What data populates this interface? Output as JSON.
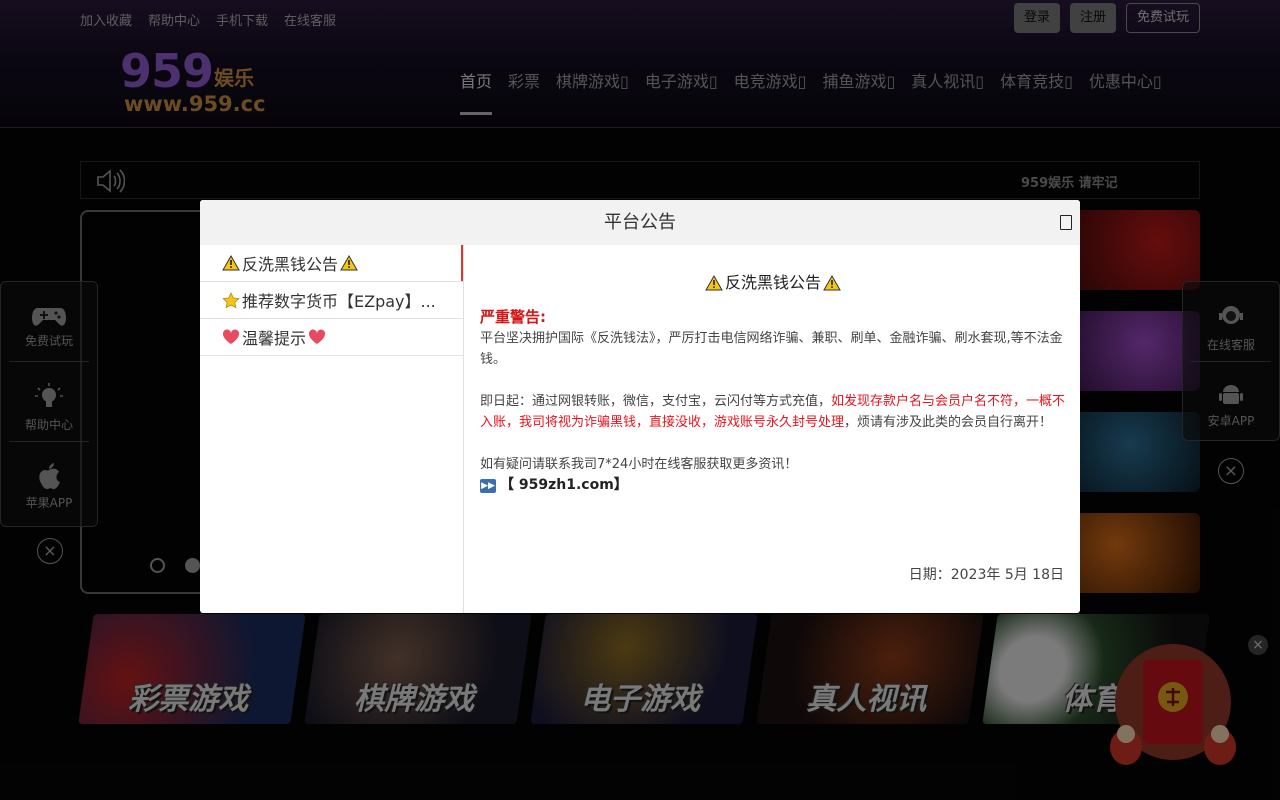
{
  "top_links": [
    "加入收藏",
    "帮助中心",
    "手机下载",
    "在线客服"
  ],
  "auth": {
    "login": "登录",
    "register": "注册",
    "trial": "免费试玩"
  },
  "logo": {
    "number": "959",
    "brand": "娱乐",
    "url": "www.959.cc"
  },
  "nav": [
    "首页",
    "彩票",
    "棋牌游戏▯",
    "电子游戏▯",
    "电竞游戏▯",
    "捕鱼游戏▯",
    "真人视讯▯",
    "体育竞技▯",
    "优惠中心▯"
  ],
  "marquee": {
    "text": "959娱乐 请牢记"
  },
  "left_widgets": [
    "免费试玩",
    "帮助中心",
    "苹果APP"
  ],
  "right_widgets": [
    "在线客服",
    "安卓APP"
  ],
  "games": [
    "彩票游戏",
    "棋牌游戏",
    "电子游戏",
    "真人视讯",
    "体育"
  ],
  "modal": {
    "title": "平台公告",
    "tabs": [
      {
        "label": "反洗黑钱公告",
        "icon": "warning-icon",
        "icon_after": "warning-icon"
      },
      {
        "label": "推荐数字货币【EZpay】...",
        "icon": "star-icon"
      },
      {
        "label": "温馨提示",
        "icon": "heart-icon",
        "icon_after": "heart-icon"
      }
    ],
    "content": {
      "title": "反洗黑钱公告",
      "warning_label": "严重警告:",
      "para1": "平台坚决拥护国际《反洗钱法》，严厉打击电信网络诈骗、兼职、刷单、金融诈骗、刷水套现,等不法金钱。",
      "para2_start": "即日起：通过网银转账，微信，支付宝，云闪付等方式充值，",
      "para2_red": "如发现存款户名与会员户名不符，一概不入账，我司将视为诈骗黑钱，直接没收，游戏账号永久封号处理",
      "para2_end": "，烦请有涉及此类的会员自行离开！",
      "para3": "如有疑问请联系我司7*24小时在线客服获取更多资讯！",
      "link": "【 959zh1.com】",
      "date": "日期：2023年 5月 18日"
    }
  },
  "colors": {
    "accent_red": "#e8141c",
    "tab_active_bar": "#d9362f"
  }
}
